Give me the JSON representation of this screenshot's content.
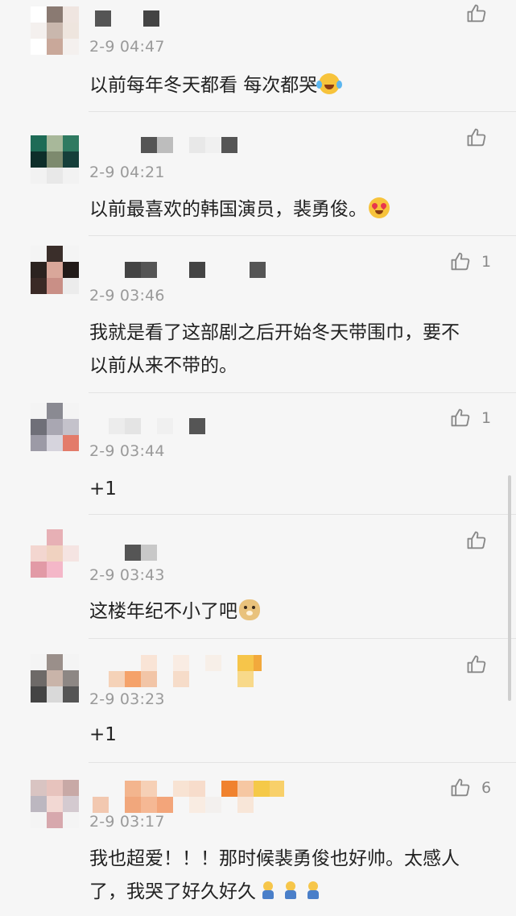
{
  "comments": [
    {
      "time": "2-9 04:47",
      "text": "以前每年冬天都看 每次都哭",
      "emoji": "laugh-cry-emoji",
      "likes": ""
    },
    {
      "time": "2-9 04:21",
      "text": "以前最喜欢的韩国演员，裴勇俊。",
      "emoji": "heart-eyes-emoji",
      "likes": ""
    },
    {
      "time": "2-9 03:46",
      "text": "我就是看了这部剧之后开始冬天带围巾，要不以前从来不带的。",
      "emoji": "",
      "likes": "1"
    },
    {
      "time": "2-9 03:44",
      "text": "+1",
      "emoji": "",
      "likes": "1"
    },
    {
      "time": "2-9 03:43",
      "text": "这楼年纪不小了吧",
      "emoji": "doge-emoji",
      "likes": ""
    },
    {
      "time": "2-9 03:23",
      "text": "+1",
      "emoji": "",
      "likes": ""
    },
    {
      "time": "2-9 03:17",
      "text": "我也超爱！！！那时候裴勇俊也好帅。太感人了，我哭了好久好久",
      "emoji": "crying-figure-emoji x3",
      "likes": "6"
    }
  ]
}
